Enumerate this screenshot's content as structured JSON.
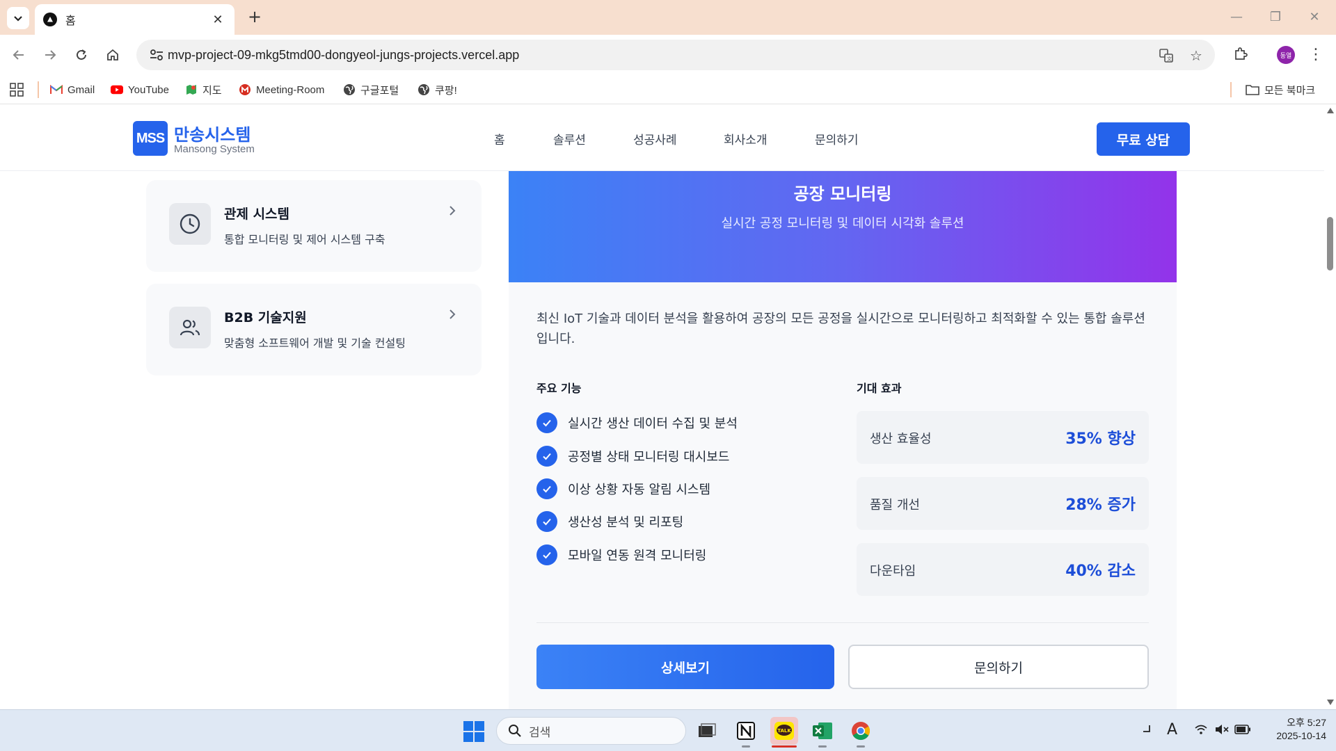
{
  "browser": {
    "tab_title": "홈",
    "url": "mvp-project-09-mkg5tmd00-dongyeol-jungs-projects.vercel.app",
    "profile_initials": "동열",
    "bookmarks": [
      {
        "label": "Gmail",
        "icon": "gmail-icon"
      },
      {
        "label": "YouTube",
        "icon": "youtube-icon"
      },
      {
        "label": "지도",
        "icon": "maps-icon"
      },
      {
        "label": "Meeting-Room",
        "icon": "meeting-room-icon"
      },
      {
        "label": "구글포털",
        "icon": "globe-icon"
      },
      {
        "label": "쿠팡!",
        "icon": "globe-icon"
      }
    ],
    "all_bookmarks": "모든 북마크"
  },
  "site": {
    "logo_mark": "MSS",
    "logo_name": "만송시스템",
    "logo_sub": "Mansong System",
    "nav": [
      "홈",
      "솔루션",
      "성공사례",
      "회사소개",
      "문의하기"
    ],
    "cta": "무료 상담",
    "brand_color": "#2563eb"
  },
  "sidebar": {
    "items": [
      {
        "title": "관제 시스템",
        "desc": "통합 모니터링 및 제어 시스템 구축",
        "icon": "clock-icon"
      },
      {
        "title": "B2B 기술지원",
        "desc": "맞춤형 소프트웨어 개발 및 기술 컨설팅",
        "icon": "users-icon"
      }
    ]
  },
  "detail": {
    "title": "공장 모니터링",
    "subtitle": "실시간 공정 모니터링 및 데이터 시각화 솔루션",
    "intro": "최신 IoT 기술과 데이터 분석을 활용하여 공장의 모든 공정을 실시간으로 모니터링하고 최적화할 수 있는 통합 솔루션입니다.",
    "features_title": "주요 기능",
    "features": [
      "실시간 생산 데이터 수집 및 분석",
      "공정별 상태 모니터링 대시보드",
      "이상 상황 자동 알림 시스템",
      "생산성 분석 및 리포팅",
      "모바일 연동 원격 모니터링"
    ],
    "effects_title": "기대 효과",
    "effects": [
      {
        "label": "생산 효율성",
        "value": "35% 향상"
      },
      {
        "label": "품질 개선",
        "value": "28% 증가"
      },
      {
        "label": "다운타임",
        "value": "40% 감소"
      }
    ],
    "btn_detail": "상세보기",
    "btn_inquiry": "문의하기"
  },
  "taskbar": {
    "search_placeholder": "검색",
    "clock_time": "오후 5:27",
    "clock_date": "2025-10-14",
    "apps": [
      "task-view-icon",
      "notion-icon",
      "kakaotalk-icon",
      "excel-icon",
      "chrome-icon"
    ]
  }
}
